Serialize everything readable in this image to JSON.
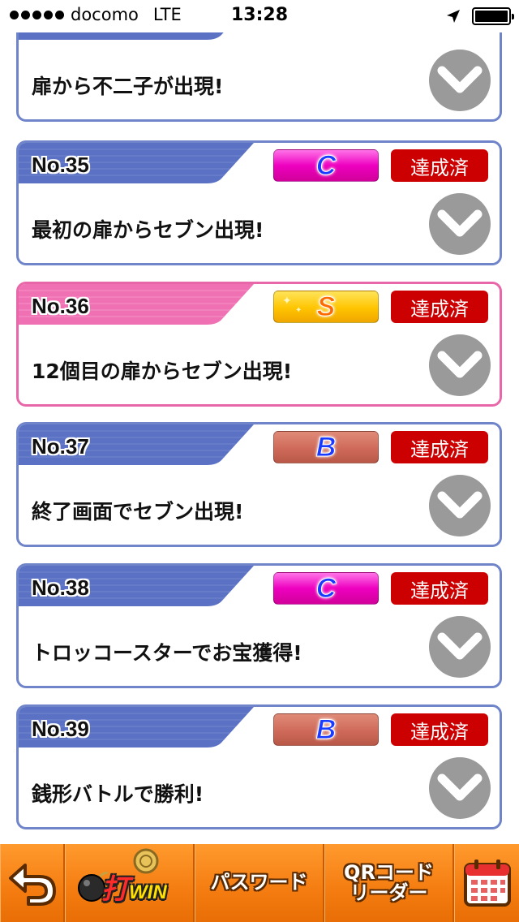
{
  "status_bar": {
    "carrier": "docomo",
    "network": "LTE",
    "time": "13:28"
  },
  "missions": [
    {
      "no": "",
      "rank": "",
      "status": "",
      "title": "扉から不二子が出現!",
      "theme": "blue"
    },
    {
      "no": "No.35",
      "rank": "C",
      "status": "達成済",
      "title": "最初の扉からセブン出現!",
      "theme": "blue"
    },
    {
      "no": "No.36",
      "rank": "S",
      "status": "達成済",
      "title": "12個目の扉からセブン出現!",
      "theme": "pink"
    },
    {
      "no": "No.37",
      "rank": "B",
      "status": "達成済",
      "title": "終了画面でセブン出現!",
      "theme": "blue"
    },
    {
      "no": "No.38",
      "rank": "C",
      "status": "達成済",
      "title": "トロッコースターでお宝獲得!",
      "theme": "blue"
    },
    {
      "no": "No.39",
      "rank": "B",
      "status": "達成済",
      "title": "銭形バトルで勝利!",
      "theme": "blue"
    }
  ],
  "toolbar": {
    "back_icon": "back-arrow-icon",
    "logo_text": "打",
    "logo_win": "WIN",
    "password_label": "パスワード",
    "qr_line1": "QRコード",
    "qr_line2": "リーダー",
    "calendar_icon": "calendar-icon"
  },
  "colors": {
    "card_border_blue": "#6f84c9",
    "card_border_pink": "#e867a8",
    "header_blue": "#5b72c4",
    "header_pink": "#f070b4",
    "achieved_red": "#cc0000",
    "toolbar_orange": "#f57a12"
  }
}
